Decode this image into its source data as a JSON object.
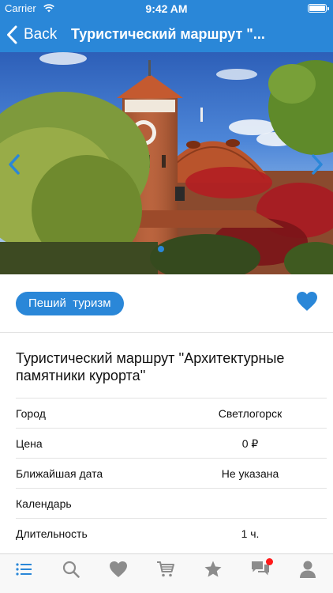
{
  "status_bar": {
    "carrier": "Carrier",
    "time": "9:42 AM"
  },
  "nav": {
    "back_label": "Back",
    "title": "Туристический маршрут \"..."
  },
  "gallery": {
    "slide_count": 1,
    "active_index": 0
  },
  "tag": {
    "label": "Пеший  туризм"
  },
  "favorite": {
    "icon": "heart-icon",
    "color": "#2a87d8"
  },
  "tour": {
    "title": "Туристический маршрут ''Архитектурные памятники курорта''"
  },
  "details": [
    {
      "label": "Город",
      "value": "Светлогорск"
    },
    {
      "label": "Цена",
      "value": "0 ₽"
    },
    {
      "label": "Ближайшая дата",
      "value": "Не указана"
    },
    {
      "label": "Календарь",
      "value": ""
    },
    {
      "label": "Длительность",
      "value": "1 ч."
    }
  ],
  "tabbar": {
    "items": [
      "list-icon",
      "search-icon",
      "heart-icon",
      "cart-icon",
      "star-icon",
      "chat-icon",
      "profile-icon"
    ],
    "active": "list-icon",
    "active_color": "#2a87d8",
    "inactive_color": "#8c8c8c",
    "badge_color": "#ff1a1a"
  },
  "colors": {
    "accent": "#2a87d8"
  }
}
